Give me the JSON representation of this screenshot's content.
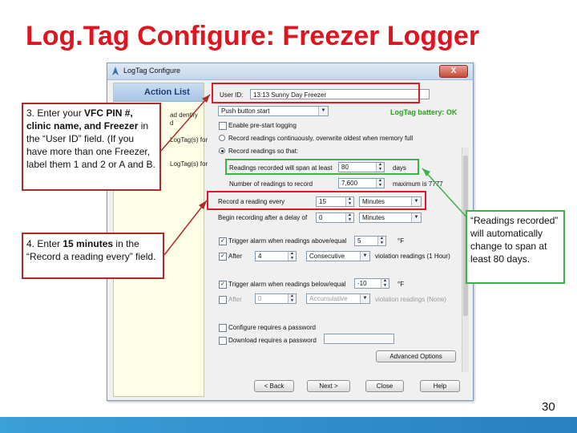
{
  "slide": {
    "title": "Log.Tag Configure: Freezer Logger",
    "page_number": "30"
  },
  "window": {
    "title": "LogTag Configure",
    "close_label": "X",
    "action_list": {
      "header": "Action List",
      "snippets": [
        "ad dentify",
        "d",
        "LogTag(s) for",
        "LogTag(s) for"
      ]
    },
    "user_id_label": "User ID:",
    "user_id_value": "13:13 Sunny Day Freezer",
    "start_option": "Push button start",
    "battery_status": "LogTag battery: OK",
    "options": {
      "enable_pre_start": "Enable pre-start logging",
      "record_continuously": "Record readings continuously, overwrite oldest when memory full",
      "record_readings_so_that": "Record readings so that:"
    },
    "readings_span_label": "Readings recorded will span at least",
    "readings_span_value": "80",
    "readings_span_unit": "days",
    "number_of_readings_label": "Number of readings to record",
    "number_of_readings_value": "7,600",
    "maximum_label": "maximum is 7777",
    "record_every_label": "Record a reading every",
    "record_every_value": "15",
    "record_every_unit": "Minutes",
    "begin_delay_label": "Begin recording after a delay of",
    "begin_delay_value": "0",
    "begin_delay_unit": "Minutes",
    "alarm_above": {
      "label": "Trigger alarm when readings above/equal",
      "value": "5",
      "unit": "°F",
      "after_label": "After",
      "after_value": "4",
      "mode": "Consecutive",
      "mode_suffix": "violation readings (1 Hour)"
    },
    "alarm_below": {
      "label": "Trigger alarm when readings below/equal",
      "value": "-10",
      "unit": "°F",
      "after_label": "After",
      "after_value": "0",
      "mode": "Accumulative",
      "mode_suffix": "violation readings (None)"
    },
    "configure_password": "Configure requires a password",
    "download_password": "Download requires a password",
    "advanced_button": "Advanced Options",
    "back_button": "< Back",
    "next_button": "Next >",
    "close_button": "Close",
    "help_button": "Help"
  },
  "callouts": {
    "user_id_note": [
      "3. Enter your ",
      "VFC PIN #, clinic name, and Freezer",
      " in the “User ID” field. (If you have more than one Freezer, label them 1 and 2 or A and B."
    ],
    "record_every_note": [
      "4. Enter ",
      "15 minutes",
      " in the “Record a reading every” field."
    ],
    "readings_note": "“Readings recorded” will automatically change to span at least 80 days."
  },
  "colors": {
    "title_red": "#e0141e",
    "highlight_red": "#e01b24",
    "highlight_green": "#3db24a",
    "battery_green": "#2aa01f",
    "bottom_bar_blue": "#2a8ccc"
  }
}
